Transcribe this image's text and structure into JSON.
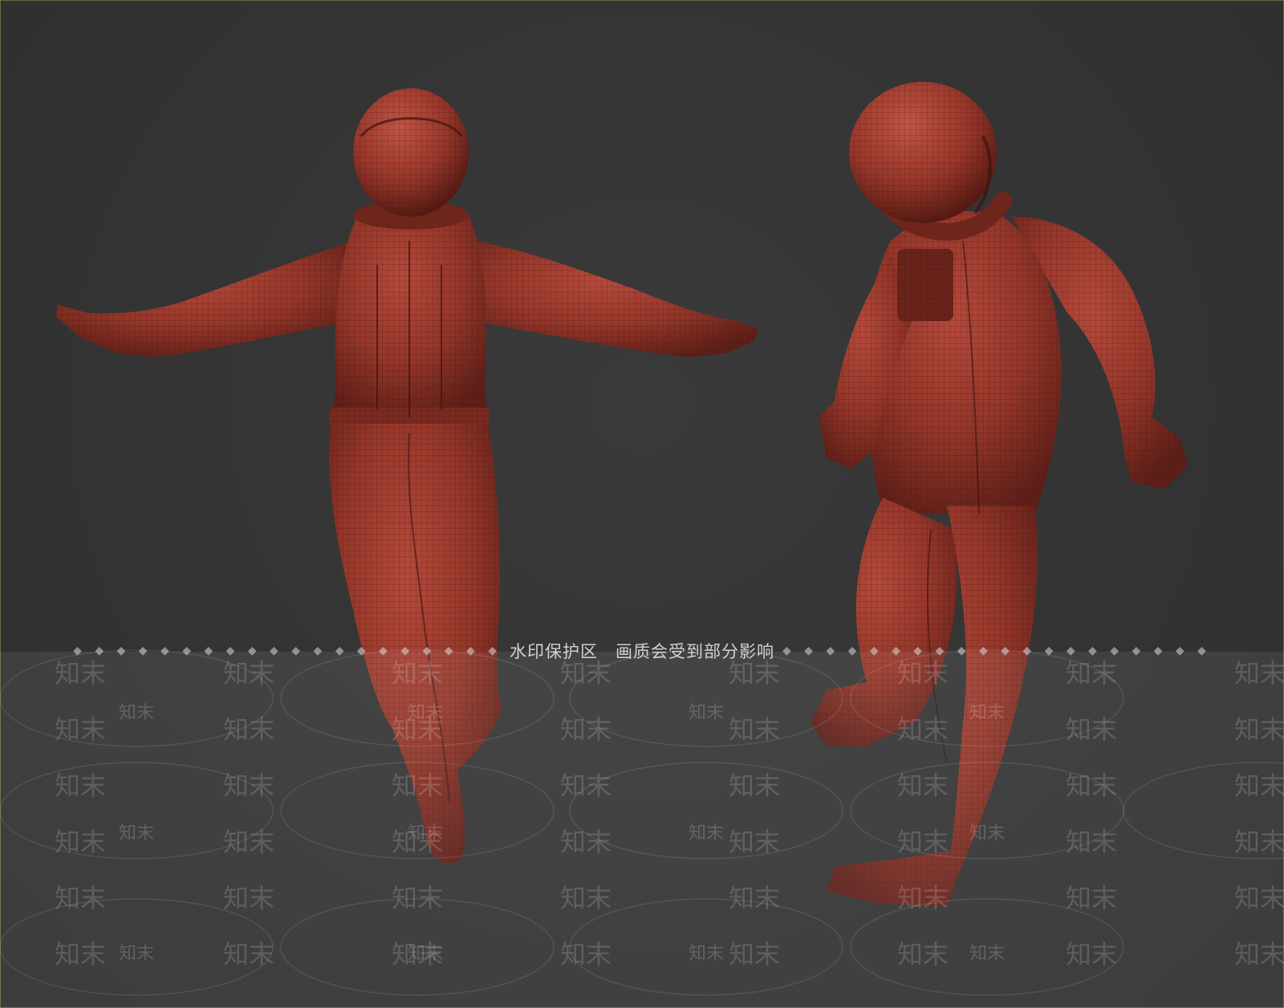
{
  "watermark": {
    "notice_left": "水印保护区",
    "notice_right": "画质会受到部分影响",
    "dots": "◆ ◆ ◆ ◆ ◆ ◆ ◆ ◆ ◆ ◆ ◆ ◆ ◆ ◆ ◆ ◆ ◆ ◆ ◆ ◆",
    "tile_text": "知末",
    "small_text": "知末"
  },
  "colors": {
    "background": "#343434",
    "suit": "#9a3a2e",
    "suit_shadow": "#5e1f18",
    "wire": "#3a1410"
  },
  "figures": [
    "astronaut-front-view",
    "astronaut-three-quarter-view"
  ]
}
